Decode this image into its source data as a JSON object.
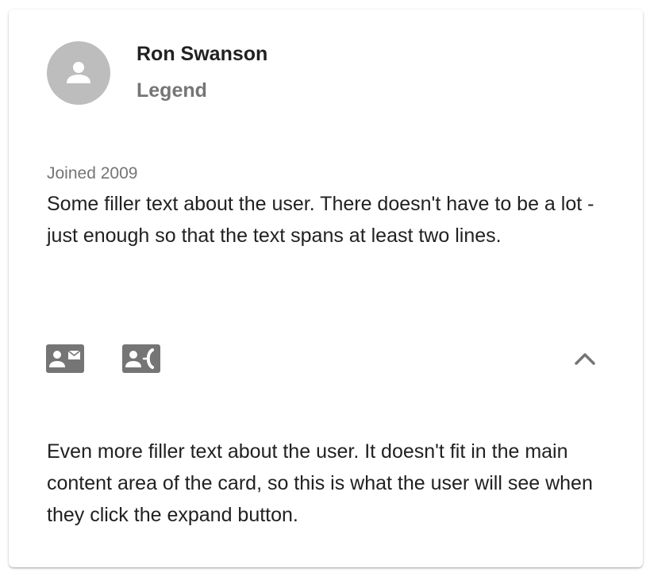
{
  "card": {
    "name": "Ron Swanson",
    "subtitle": "Legend",
    "joined": "Joined 2009",
    "description": "Some filler text about the user. There doesn't have to be a lot - just enough so that the text spans at least two lines.",
    "expanded_text": "Even more filler text about the user. It doesn't fit in the main content area of the card, so this is what the user will see when they click the expand button.",
    "expanded": true
  },
  "icons": {
    "avatar": "person-icon",
    "email_action": "contact-mail-icon",
    "phone_action": "contact-phone-icon",
    "expand": "chevron-up-icon"
  },
  "colors": {
    "avatar_bg": "#bdbdbd",
    "icon": "#757575",
    "text_primary": "#212121",
    "text_secondary": "#757575"
  }
}
